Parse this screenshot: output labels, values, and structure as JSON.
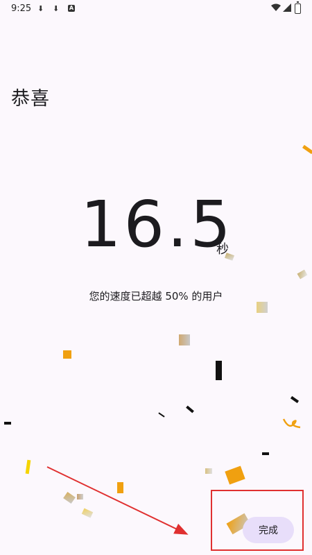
{
  "status_bar": {
    "time": "9:25",
    "icons": [
      "download-icon",
      "download-icon",
      "app-badge-icon",
      "wifi-icon",
      "signal-icon",
      "battery-icon"
    ],
    "badge_letter": "A"
  },
  "page": {
    "title": "恭喜",
    "result_value": "16.5",
    "result_unit": "秒",
    "speed_text": "您的速度已超越 50% 的用户"
  },
  "actions": {
    "done_label": "完成"
  },
  "colors": {
    "background": "#fcf8fd",
    "button_bg": "#e8defa",
    "annotation_red": "#e03030",
    "confetti_gold": "#f0a010",
    "confetti_yellow": "#f5d400"
  }
}
